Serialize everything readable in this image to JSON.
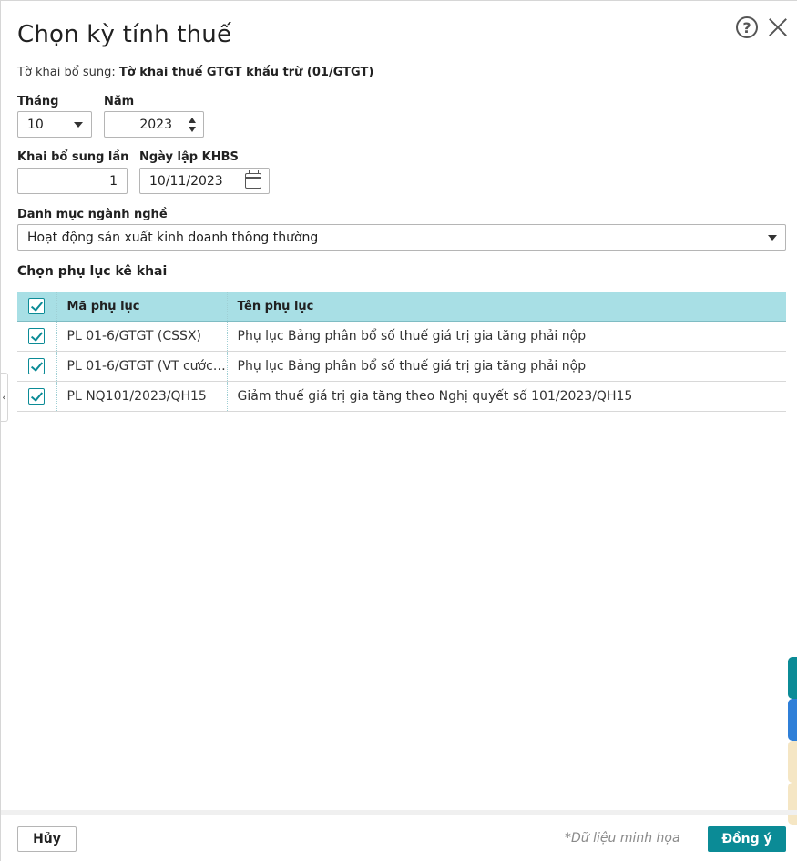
{
  "dialog": {
    "title": "Chọn kỳ tính thuế",
    "declaration_label": "Tờ khai bổ sung:",
    "declaration_value": "Tờ khai thuế GTGT khấu trừ (01/GTGT)"
  },
  "form": {
    "month_label": "Tháng",
    "month_value": "10",
    "year_label": "Năm",
    "year_value": "2023",
    "supplement_label": "Khai bổ sung lần",
    "supplement_value": "1",
    "date_label": "Ngày lập KHBS",
    "date_value": "10/11/2023",
    "industry_label": "Danh mục ngành nghề",
    "industry_value": "Hoạt động sản xuất kinh doanh thông thường"
  },
  "appendix": {
    "section_label": "Chọn phụ lục kê khai",
    "columns": {
      "code": "Mã phụ lục",
      "name": "Tên phụ lục"
    },
    "rows": [
      {
        "code": "PL 01-6/GTGT (CSSX)",
        "name": "Phụ lục Bảng phân bổ số thuế giá trị gia tăng phải nộp",
        "checked": true
      },
      {
        "code": "PL 01-6/GTGT (VT cước…",
        "name": "Phụ lục Bảng phân bổ số thuế giá trị gia tăng phải nộp",
        "checked": true
      },
      {
        "code": "PL NQ101/2023/QH15",
        "name": "Giảm thuế giá trị gia tăng theo Nghị quyết số 101/2023/QH15",
        "checked": true
      }
    ]
  },
  "footer": {
    "cancel_label": "Hủy",
    "demo_note": "*Dữ liệu minh họa",
    "ok_label": "Đồng ý"
  },
  "colors": {
    "accent": "#0b8b96",
    "header_bg": "#a8dfe5",
    "side_tab_1": "#0b8b96",
    "side_tab_2": "#2f7fd8",
    "side_tab_3": "#f5e6c4",
    "side_tab_4": "#f5e6c4"
  }
}
